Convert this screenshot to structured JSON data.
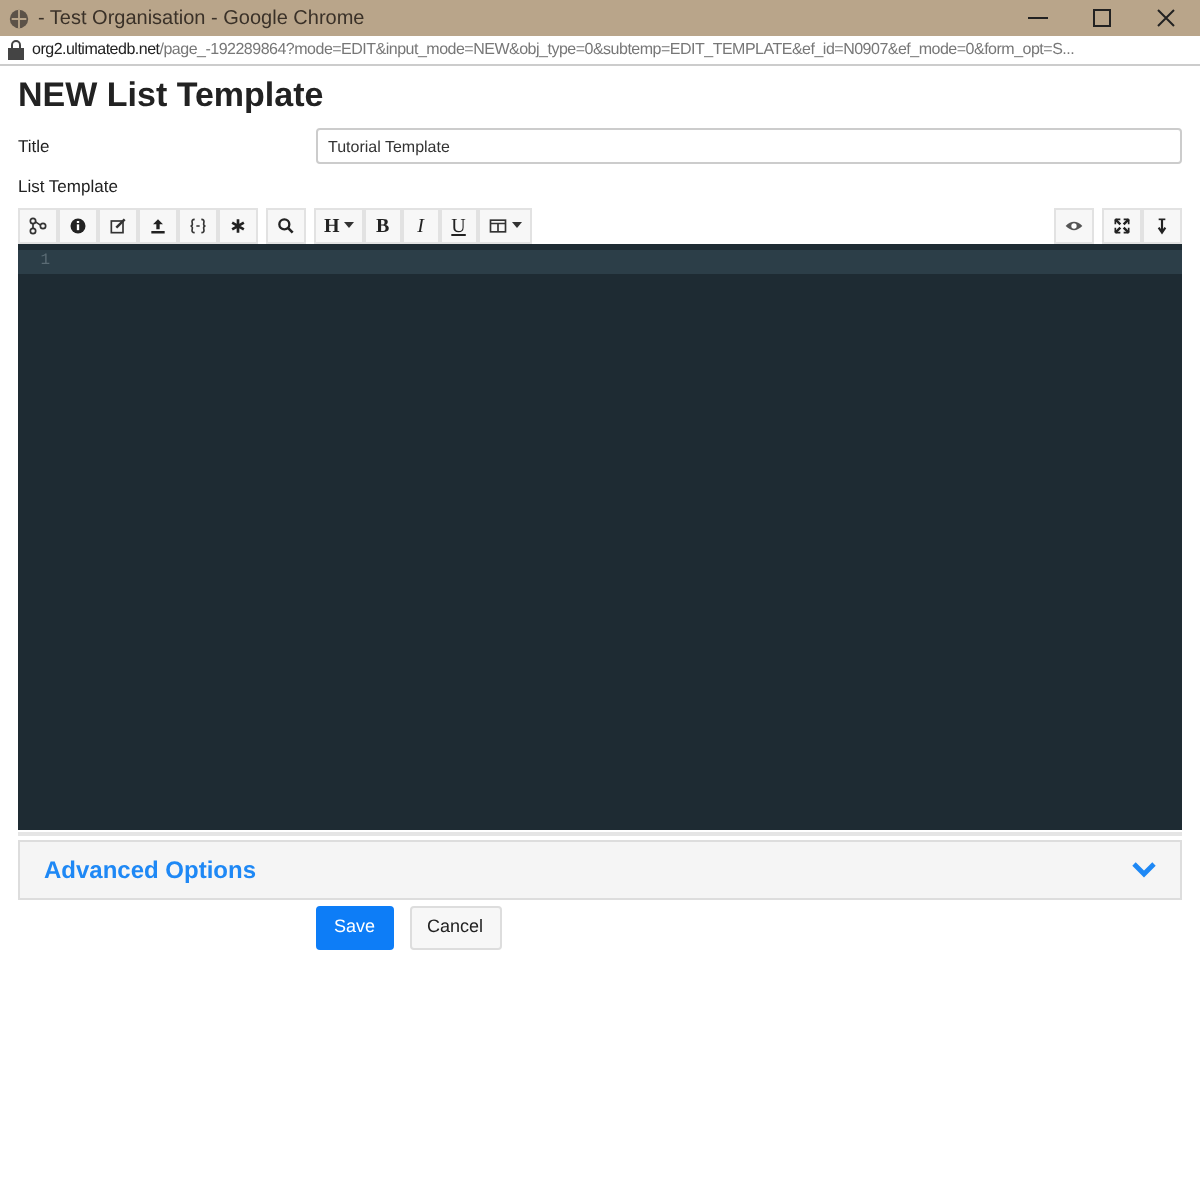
{
  "window": {
    "title": "- Test Organisation - Google Chrome",
    "url_host": "org2.ultimatedb.net",
    "url_path": "/page_-192289864?mode=EDIT&input_mode=NEW&obj_type=0&subtemp=EDIT_TEMPLATE&ef_id=N0907&ef_mode=0&form_opt=S..."
  },
  "heading": "NEW List Template",
  "title_field": {
    "label": "Title",
    "value": "Tutorial Template"
  },
  "template_label": "List Template",
  "toolbar_left": [
    {
      "kind": "icon"
    },
    {
      "kind": "icon"
    },
    {
      "kind": "icon"
    },
    {
      "kind": "icon"
    },
    {
      "kind": "icon"
    },
    {
      "kind": "icon"
    },
    {
      "kind": "sep"
    },
    {
      "kind": "icon"
    },
    {
      "kind": "sep"
    },
    {
      "kind": "text",
      "label": "H",
      "dropdown": true
    },
    {
      "kind": "text",
      "label": "B"
    },
    {
      "kind": "text",
      "label": "I"
    },
    {
      "kind": "text",
      "label": "U"
    },
    {
      "kind": "icon",
      "dropdown": true
    }
  ],
  "toolbar_right": [
    {
      "kind": "icon"
    },
    {
      "kind": "sep"
    },
    {
      "kind": "icon"
    },
    {
      "kind": "icon"
    }
  ],
  "editor": {
    "line_numbers": [
      "1"
    ]
  },
  "advanced": {
    "label": "Advanced Options",
    "expanded": false
  },
  "buttons": [
    {
      "label": "Save",
      "kind": "primary"
    },
    {
      "label": "Cancel",
      "kind": "secondary"
    }
  ]
}
